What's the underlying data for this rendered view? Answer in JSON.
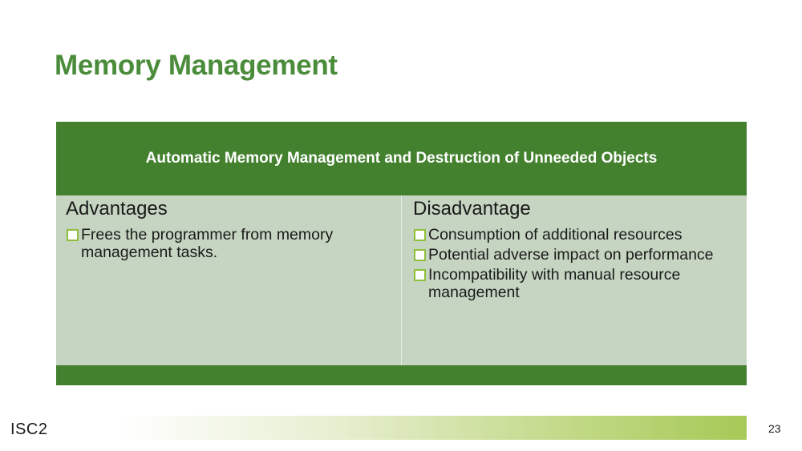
{
  "slide": {
    "title": "Memory Management",
    "page_number": "23"
  },
  "table": {
    "header": "Automatic Memory Management and Destruction of Unneeded Objects",
    "advantages": {
      "heading": "Advantages",
      "items": [
        "Frees the programmer from memory management tasks."
      ]
    },
    "disadvantages": {
      "heading": "Disadvantage",
      "items": [
        "Consumption of additional resources",
        "Potential adverse impact on performance",
        "Incompatibility with manual resource management"
      ]
    }
  },
  "footer": {
    "logo_text": "ISC2"
  },
  "colors": {
    "title_green": "#4a8c3a",
    "header_green": "#44812f",
    "cell_green": "#c5d5c1",
    "bullet_green": "#8fbf3a"
  },
  "icons": {
    "bullet": "checkbox-icon"
  }
}
